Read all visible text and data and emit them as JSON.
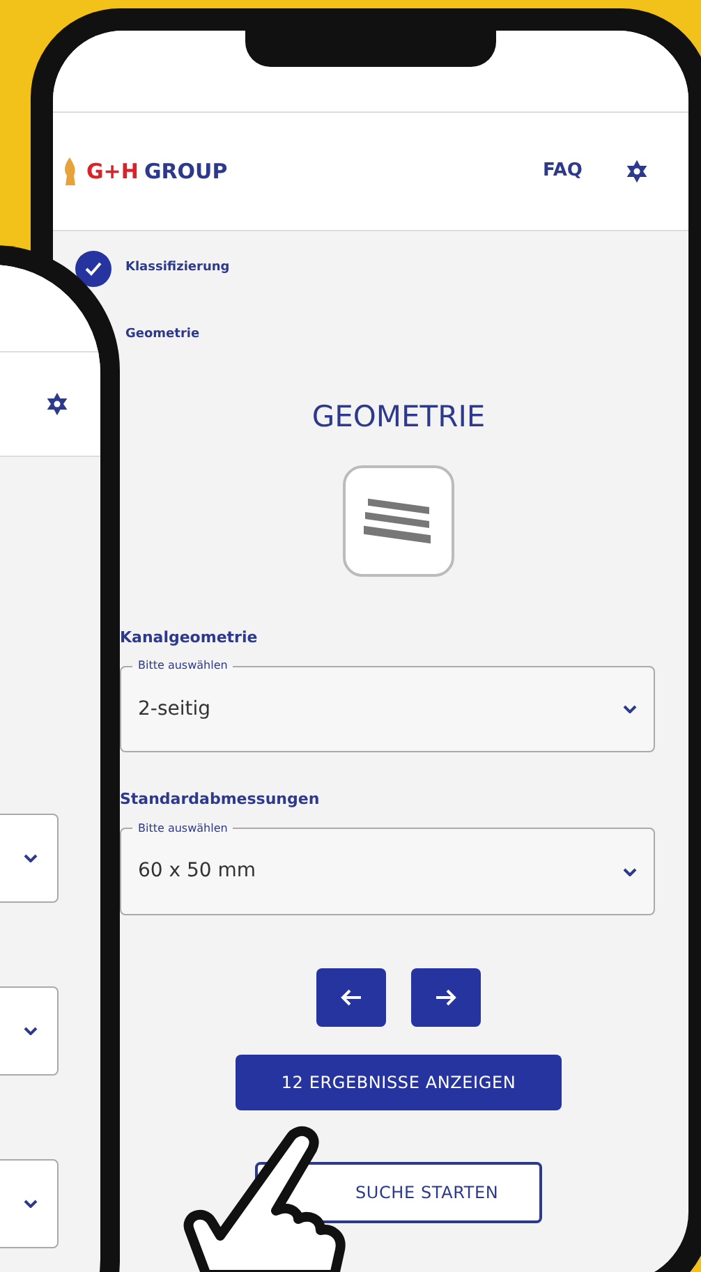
{
  "header": {
    "logo_mark": "G+H",
    "logo_text": "GROUP",
    "faq": "FAQ"
  },
  "steps": [
    {
      "label": "Klassifizierung",
      "kind": "completed"
    },
    {
      "label": "Geometrie",
      "kind": "current"
    }
  ],
  "title": "GEOMETRIE",
  "fields": [
    {
      "label": "Kanalgeometrie",
      "legend": "Bitte auswählen",
      "value": "2-seitig"
    },
    {
      "label": "Standardabmessungen",
      "legend": "Bitte auswählen",
      "value": "60 x 50 mm"
    }
  ],
  "primary_button": "12 ERGEBNISSE ANZEIGEN",
  "secondary_button": "SUCHE STARTEN"
}
